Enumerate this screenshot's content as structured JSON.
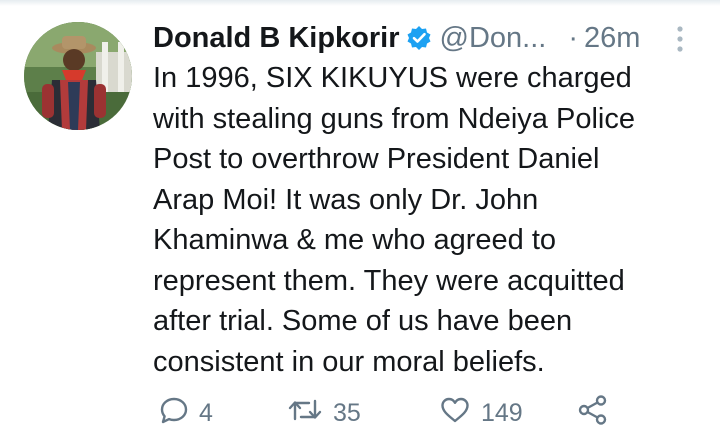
{
  "tweet": {
    "author": {
      "display_name": "Donald B Kipkorir",
      "handle": "@Don...",
      "verified": true
    },
    "separator": "·",
    "timestamp": "26m",
    "text": "In 1996, SIX KIKUYUS were charged\nwith stealing guns from Ndeiya Police\nPost to overthrow President Daniel\nArap Moi! It was only Dr. John\nKhaminwa & me who agreed to\nrepresent them. They were acquitted\nafter trial. Some of us have been\nconsistent in our moral beliefs.",
    "actions": {
      "replies": "4",
      "retweets": "35",
      "likes": "149"
    }
  },
  "icons": {
    "verified": "verified-badge-icon",
    "more": "more-vertical-icon",
    "reply": "reply-icon",
    "retweet": "retweet-icon",
    "like": "heart-icon",
    "share": "share-icon"
  },
  "colors": {
    "text": "#14171a",
    "secondary": "#657786",
    "verified_blue": "#1da1f2"
  }
}
